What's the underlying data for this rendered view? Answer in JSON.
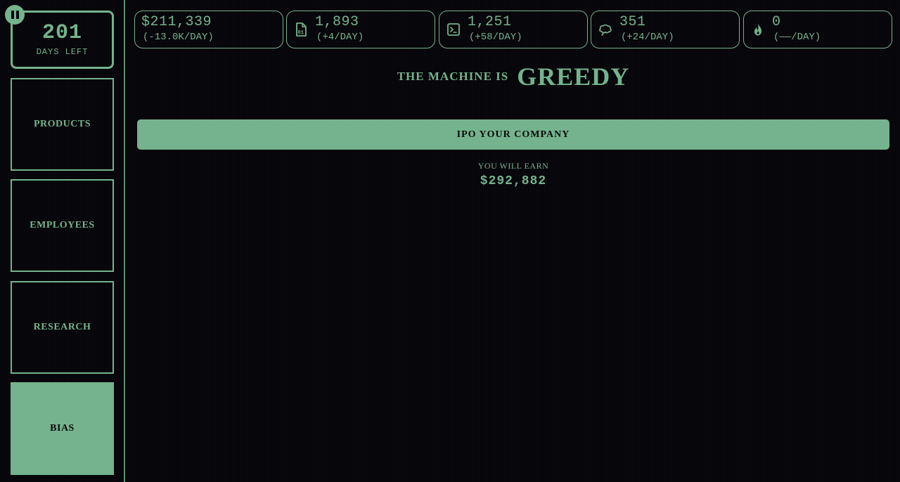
{
  "pause": {
    "icon": "pause-icon"
  },
  "days": {
    "value": "201",
    "label": "DAYS LEFT"
  },
  "nav": [
    {
      "label": "PRODUCTS",
      "active": false
    },
    {
      "label": "EMPLOYEES",
      "active": false
    },
    {
      "label": "RESEARCH",
      "active": false
    },
    {
      "label": "BIAS",
      "active": true
    }
  ],
  "stats": [
    {
      "value": "$211,339",
      "rate": "(-13.0K/DAY)",
      "icon": ""
    },
    {
      "value": "1,893",
      "rate": "(+4/DAY)",
      "icon": "data-file-icon"
    },
    {
      "value": "1,251",
      "rate": "(+58/DAY)",
      "icon": "terminal-icon"
    },
    {
      "value": "351",
      "rate": "(+24/DAY)",
      "icon": "brain-icon"
    },
    {
      "value": "0",
      "rate": "(——/DAY)",
      "icon": "flame-icon"
    }
  ],
  "headline": {
    "lead": "THE MACHINE IS",
    "mood": "GREEDY"
  },
  "ipo": {
    "button_label": "IPO YOUR COMPANY",
    "earn_label": "YOU WILL EARN",
    "earn_value": "$292,882"
  },
  "colors": {
    "accent": "#74b38d",
    "background": "#060509"
  }
}
